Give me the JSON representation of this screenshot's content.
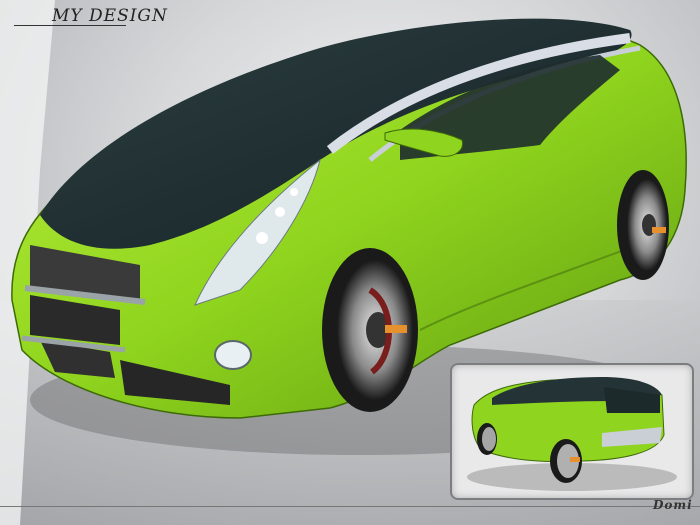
{
  "header": {
    "title": "MY DESIGN"
  },
  "footer": {
    "signature": "Domi"
  },
  "colors": {
    "body": "#8fd41e",
    "roof": "#243538",
    "accent": "#e6902e"
  }
}
